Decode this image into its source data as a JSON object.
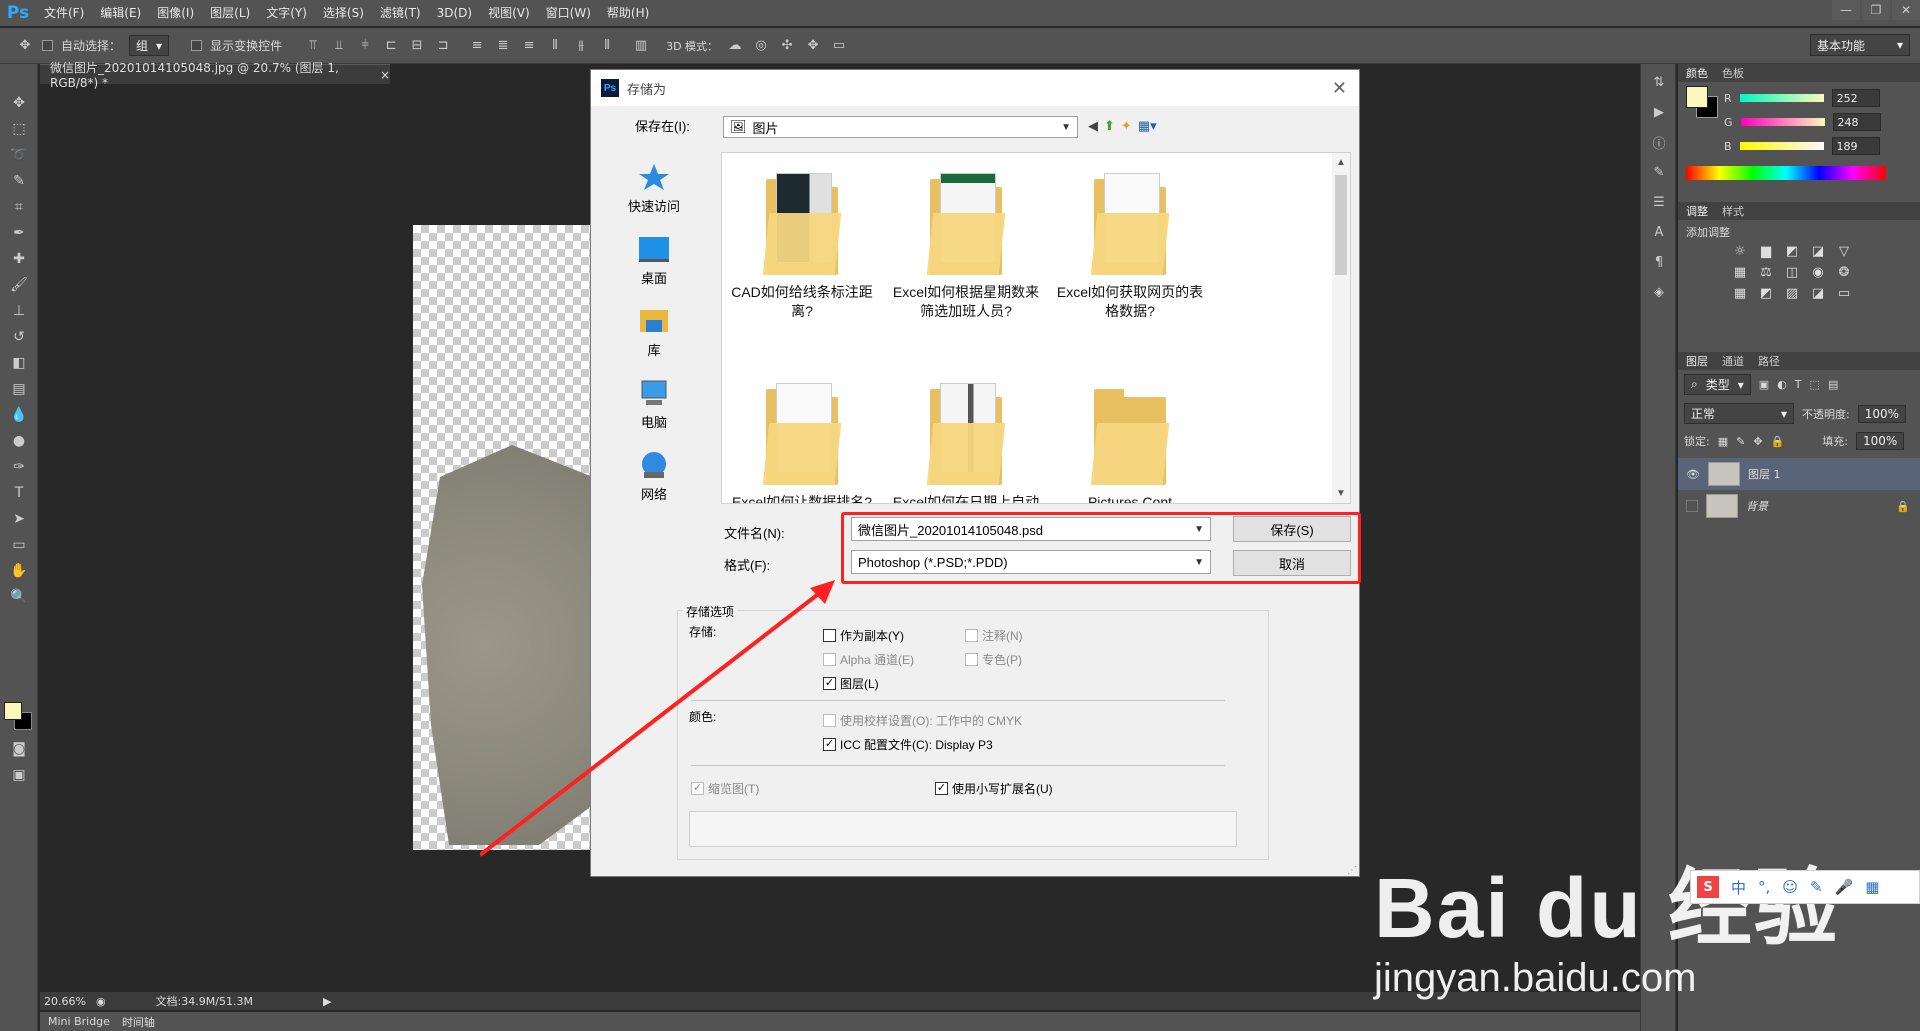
{
  "app": {
    "logo": "Ps",
    "menu": [
      "文件(F)",
      "编辑(E)",
      "图像(I)",
      "图层(L)",
      "文字(Y)",
      "选择(S)",
      "滤镜(T)",
      "3D(D)",
      "视图(V)",
      "窗口(W)",
      "帮助(H)"
    ],
    "window_buttons": [
      "—",
      "❐",
      "✕"
    ]
  },
  "options_bar": {
    "auto_select_label": "自动选择：",
    "auto_select_value": "组",
    "show_transform_label": "显示变换控件",
    "mode_3d_label": "3D 模式：",
    "workspace": "基本功能"
  },
  "document": {
    "tab_title": "微信图片_20201014105048.jpg @ 20.7% (图层 1, RGB/8*) *",
    "tab_close": "×"
  },
  "status": {
    "zoom": "20.66%",
    "doc_size": "文档:34.9M/51.3M"
  },
  "bottom_tabs": [
    "Mini Bridge",
    "时间轴"
  ],
  "color_panel": {
    "tabs": [
      "颜色",
      "色板"
    ],
    "r_label": "R",
    "r_value": "252",
    "g_label": "G",
    "g_value": "248",
    "b_label": "B",
    "b_value": "189",
    "fg_color": "#fcf8bd"
  },
  "adjust_panel": {
    "tabs": [
      "调整",
      "样式"
    ],
    "add_label": "添加调整"
  },
  "layers_panel": {
    "tabs": [
      "图层",
      "通道",
      "路径"
    ],
    "filter_kind": "类型",
    "blend_mode": "正常",
    "opacity_label": "不透明度:",
    "opacity_value": "100%",
    "lock_label": "锁定:",
    "fill_label": "填充:",
    "fill_value": "100%",
    "layers": [
      {
        "name": "图层 1",
        "selected": true,
        "visible": true
      },
      {
        "name": "背景",
        "selected": false,
        "visible": false,
        "locked": true
      }
    ]
  },
  "dialog": {
    "title": "存储为",
    "save_in_label": "保存在(I):",
    "save_in_value": "图片",
    "places": [
      "快速访问",
      "桌面",
      "库",
      "电脑",
      "网络"
    ],
    "files": [
      {
        "name": "CAD如何给线条标注距离?"
      },
      {
        "name": "Excel如何根据星期数来筛选加班人员?"
      },
      {
        "name": "Excel如何获取网页的表格数据?"
      },
      {
        "name": "Excel如何让数据排名?"
      },
      {
        "name": "Excel如何在日期上自动"
      },
      {
        "name": "Pictures Cont"
      }
    ],
    "filename_label": "文件名(N):",
    "filename_value": "微信图片_20201014105048.psd",
    "format_label": "格式(F):",
    "format_value": "Photoshop (*.PSD;*.PDD)",
    "save_button": "保存(S)",
    "cancel_button": "取消",
    "options_title": "存储选项",
    "store_label": "存储:",
    "opt_copy": "作为副本(Y)",
    "opt_notes": "注释(N)",
    "opt_alpha": "Alpha 通道(E)",
    "opt_spot": "专色(P)",
    "opt_layers": "图层(L)",
    "color_label": "颜色:",
    "opt_proof": "使用校样设置(O):  工作中的 CMYK",
    "opt_icc": "ICC 配置文件(C):  Display P3",
    "opt_thumb": "缩览图(T)",
    "opt_lowercase": "使用小写扩展名(U)"
  },
  "watermark": {
    "brand": "Bai du 经验",
    "url": "jingyan.baidu.com"
  },
  "ime_bar": {
    "logo": "S",
    "items": [
      "中",
      "°,",
      "☺",
      "✎",
      "🎤",
      "▦"
    ]
  }
}
